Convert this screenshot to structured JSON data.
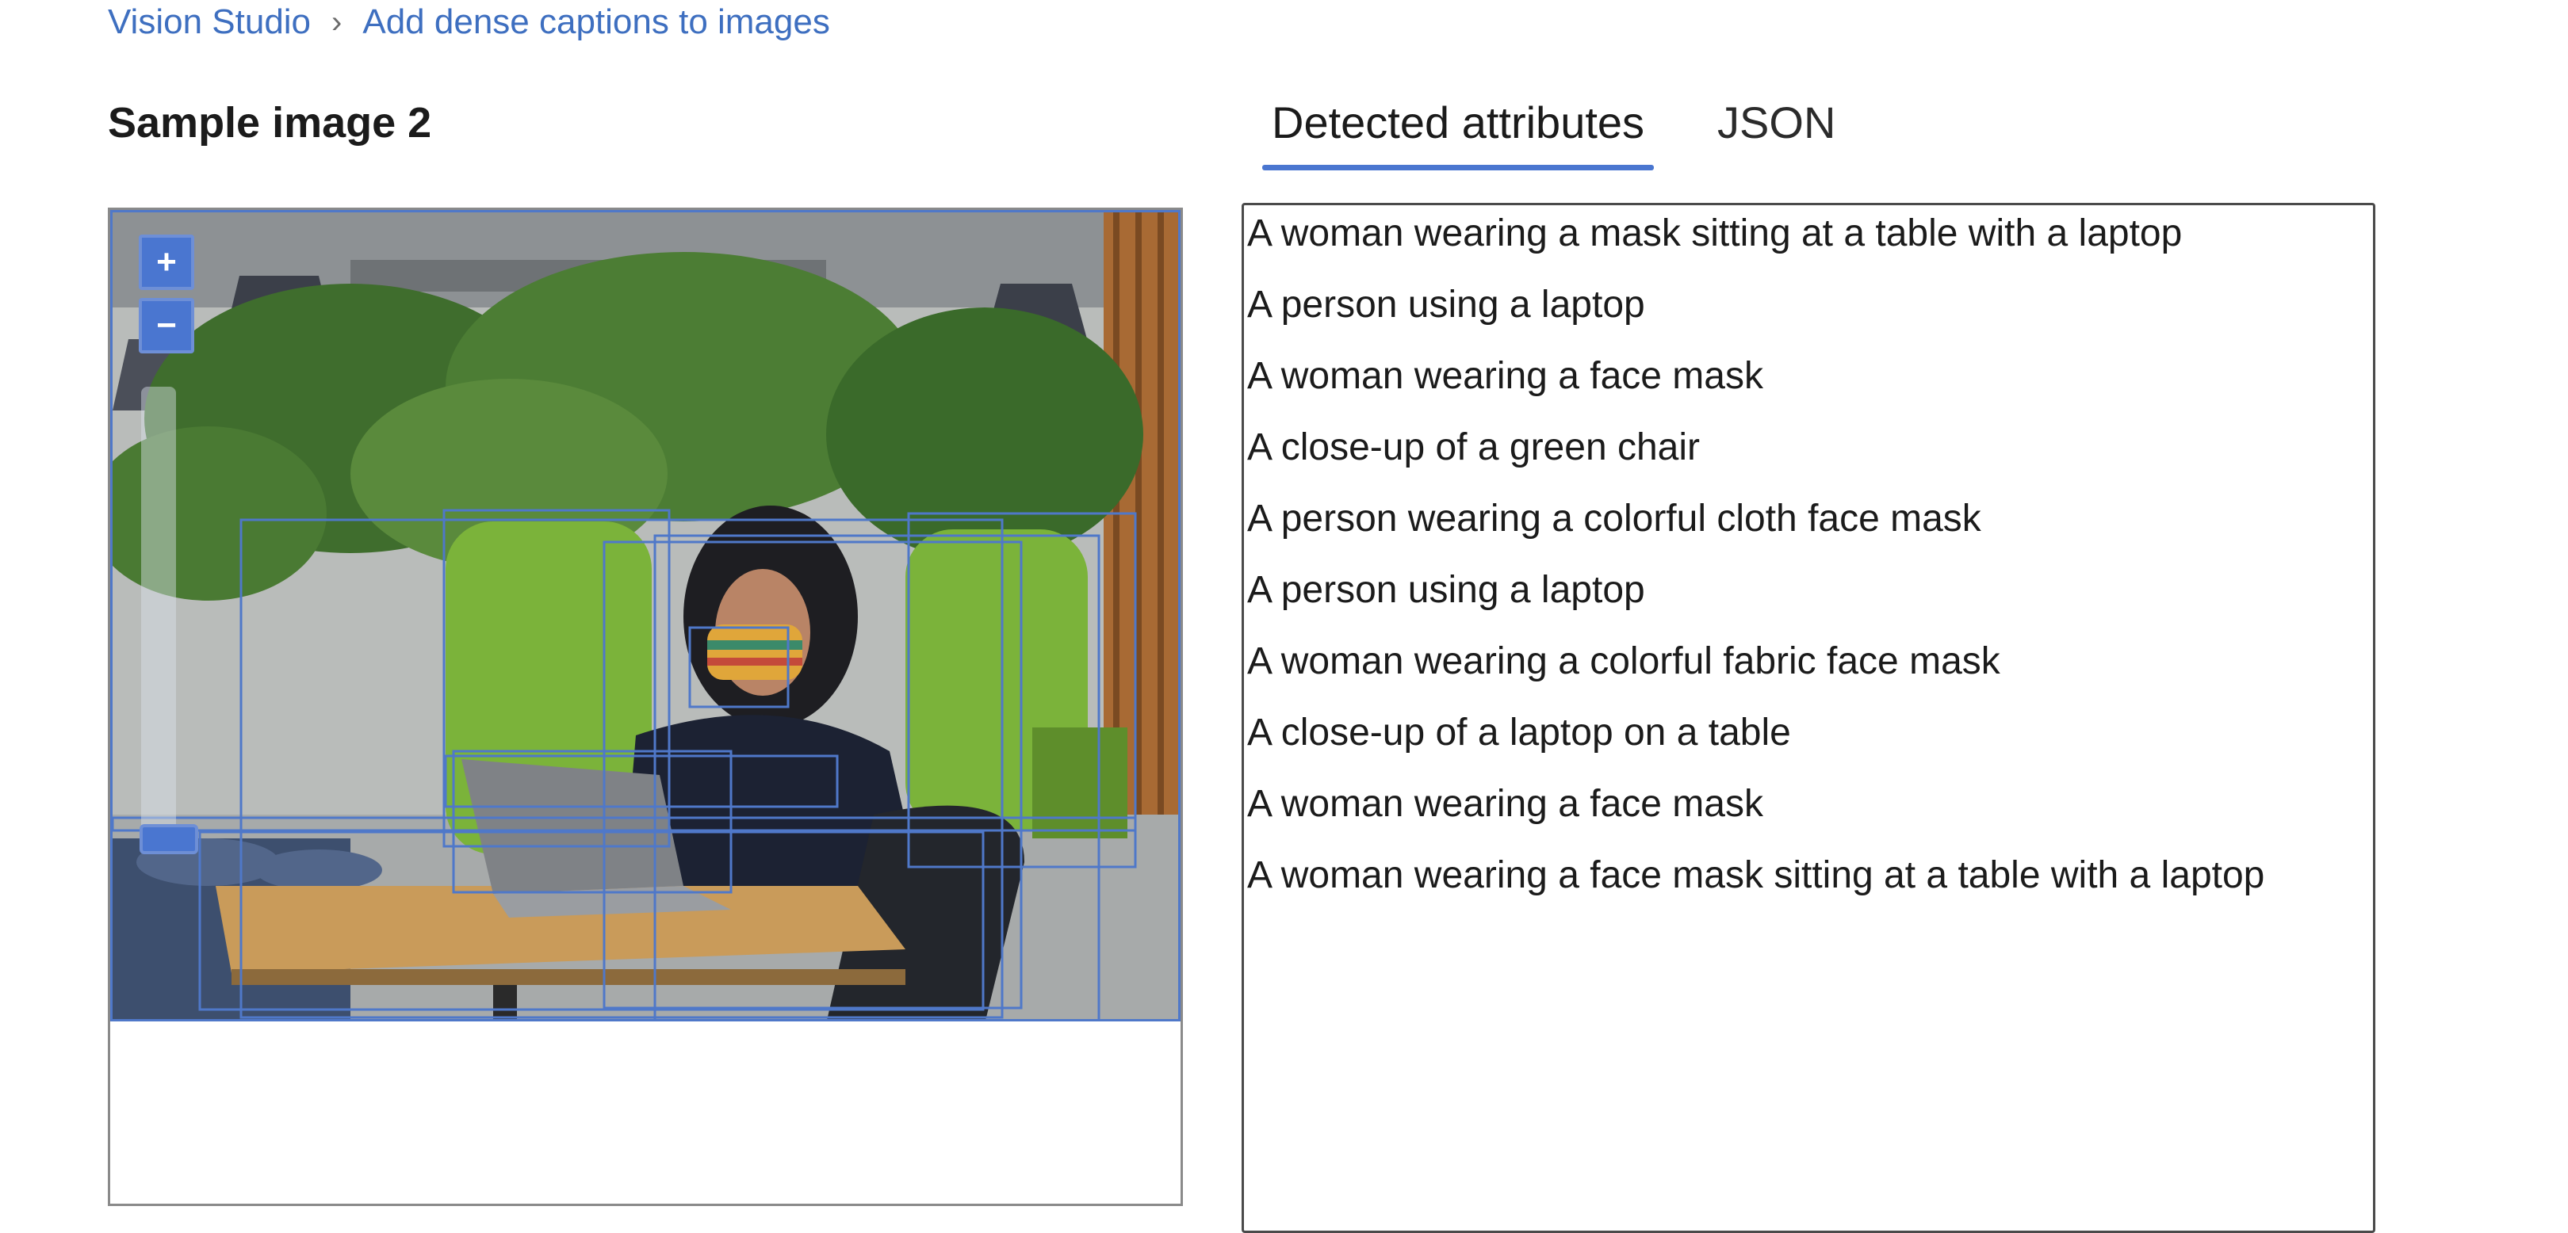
{
  "breadcrumb": {
    "items": [
      "Vision Studio",
      "Add dense captions to images"
    ],
    "separator": "›"
  },
  "page_title": "Sample image 2",
  "viewer": {
    "zoom_in_label": "+",
    "zoom_out_label": "−"
  },
  "tabs": [
    {
      "label": "Detected attributes",
      "active": true
    },
    {
      "label": "JSON",
      "active": false
    }
  ],
  "captions": [
    "A woman wearing a mask sitting at a table with a laptop",
    "A person using a laptop",
    "A woman wearing a face mask",
    "A close-up of a green chair",
    "A person wearing a colorful cloth face mask",
    "A person using a laptop",
    "A woman wearing a colorful fabric face mask",
    "A close-up of a laptop on a table",
    "A woman wearing a face mask",
    "A woman wearing a face mask sitting at a table with a laptop"
  ],
  "colors": {
    "accent": "#4a76d0",
    "link": "#3e6fc0",
    "box_outline": "#4f78c9"
  }
}
